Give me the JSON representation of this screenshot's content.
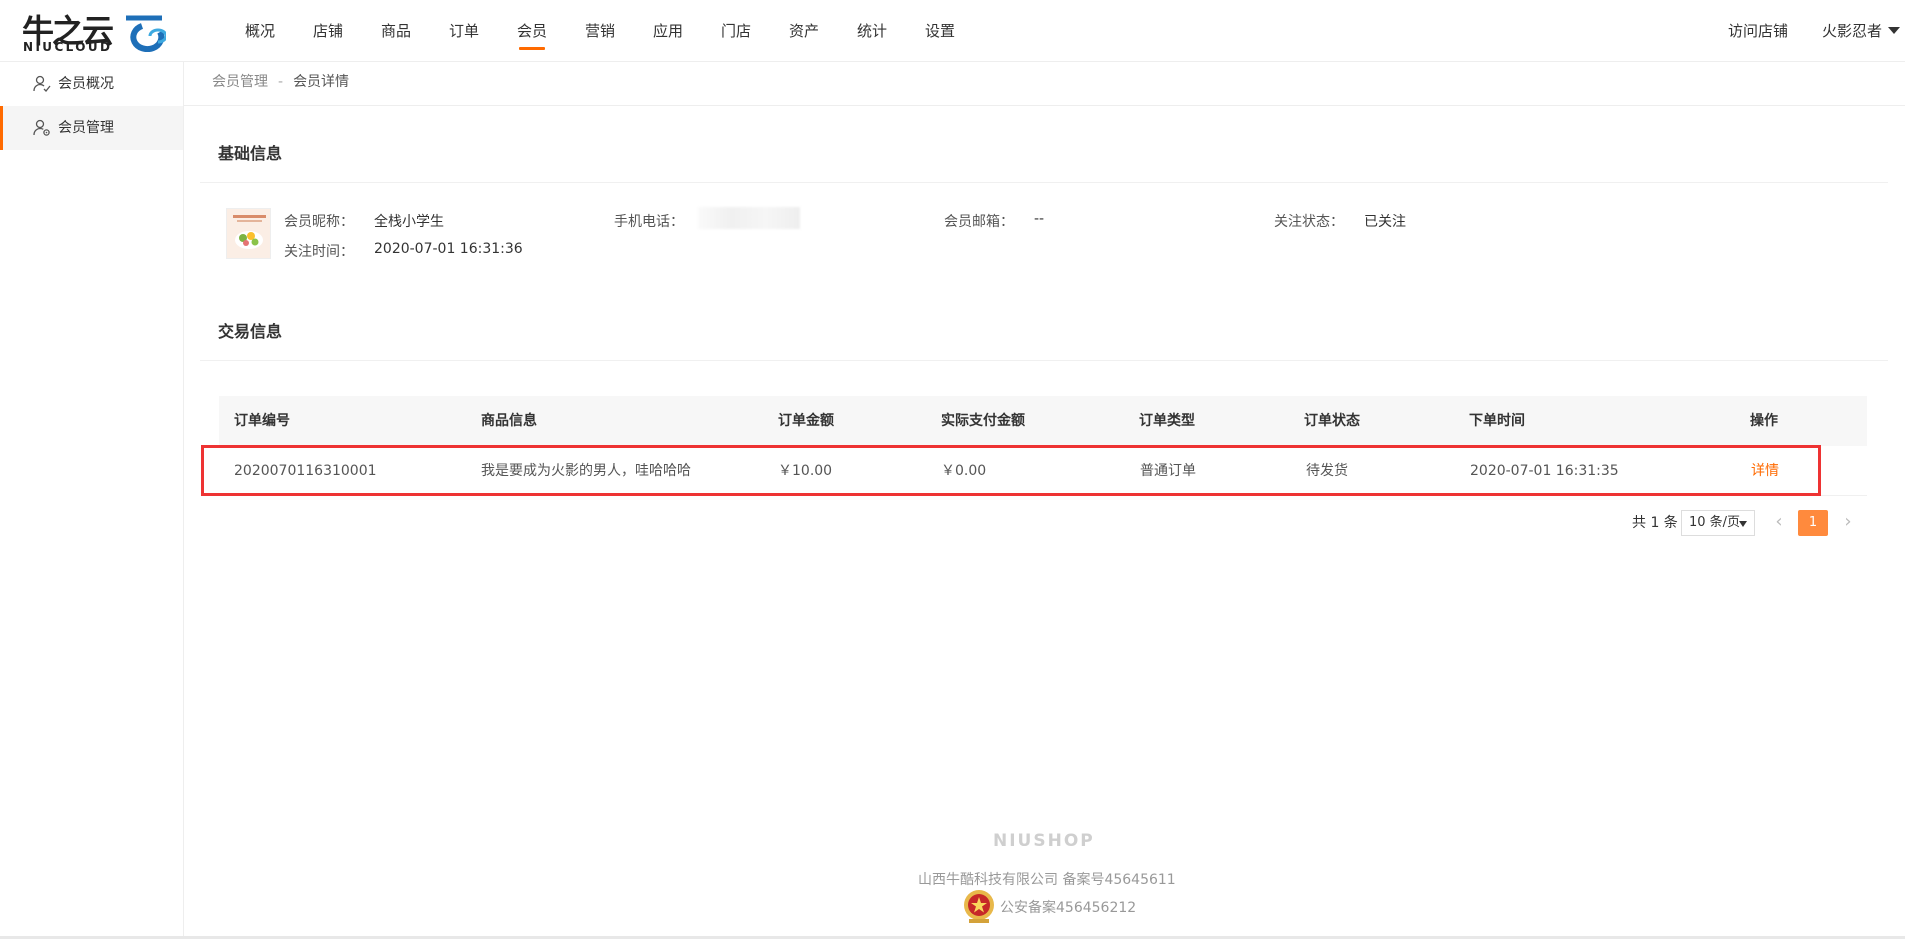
{
  "brand": {
    "logo_cn": "牛之云",
    "logo_en": "NIUCLOUD"
  },
  "top_nav": {
    "items": [
      {
        "label": "概况"
      },
      {
        "label": "店铺"
      },
      {
        "label": "商品"
      },
      {
        "label": "订单"
      },
      {
        "label": "会员",
        "active": true
      },
      {
        "label": "营销"
      },
      {
        "label": "应用"
      },
      {
        "label": "门店"
      },
      {
        "label": "资产"
      },
      {
        "label": "统计"
      },
      {
        "label": "设置"
      }
    ],
    "visit_store": "访问店铺",
    "user_name": "火影忍者"
  },
  "sidebar": {
    "items": [
      {
        "label": "会员概况",
        "icon": "user-check-icon"
      },
      {
        "label": "会员管理",
        "icon": "user-settings-icon",
        "active": true
      }
    ]
  },
  "breadcrumb": {
    "parent": "会员管理",
    "separator": "-",
    "current": "会员详情"
  },
  "basic_info": {
    "title": "基础信息",
    "nickname_label": "会员昵称：",
    "nickname": "全栈小学生",
    "phone_label": "手机电话：",
    "email_label": "会员邮箱：",
    "email": "--",
    "follow_status_label": "关注状态：",
    "follow_status": "已关注",
    "follow_time_label": "关注时间：",
    "follow_time": "2020-07-01 16:31:36"
  },
  "trade_info": {
    "title": "交易信息",
    "columns": [
      "订单编号",
      "商品信息",
      "订单金额",
      "实际支付金额",
      "订单类型",
      "订单状态",
      "下单时间",
      "操作"
    ],
    "rows": [
      {
        "order_no": "2020070116310001",
        "goods": "我是要成为火影的男人，哇哈哈哈",
        "amount": "￥10.00",
        "paid": "￥0.00",
        "type": "普通订单",
        "status": "待发货",
        "time": "2020-07-01 16:31:35",
        "action": "详情"
      }
    ]
  },
  "pagination": {
    "total": "共 1 条",
    "page_size": "10 条/页",
    "current_page": "1",
    "prev": "‹",
    "next": "›"
  },
  "footer": {
    "brand": "NIUSHOP",
    "company": "山西牛酷科技有限公司  备案号45645611",
    "police": "公安备案456456212"
  },
  "colors": {
    "accent": "#ff6a00",
    "highlight_box": "#ee3333",
    "page_active": "#ff8a3d"
  }
}
